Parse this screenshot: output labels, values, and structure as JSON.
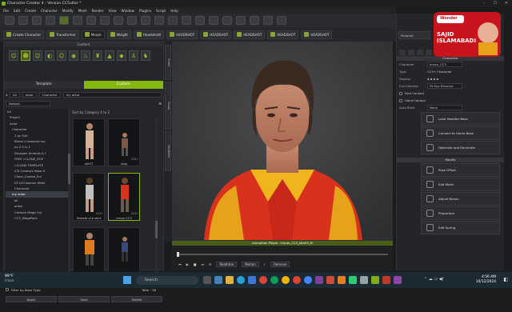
{
  "window": {
    "title": "Character Creator 4 - Version CC5ultar *"
  },
  "menu": [
    "File",
    "Edit",
    "Create",
    "Character",
    "Modify",
    "Mesh",
    "Render",
    "View",
    "Window",
    "Plugins",
    "Script",
    "Help"
  ],
  "toolbar2": {
    "create_character": "Create Character",
    "transformer": "Transformer",
    "morph_label": "Morph",
    "weight_label": "Weight",
    "pose_label": "HeadshotX",
    "headshot1": "HEADSHOT",
    "headshot2": "HEADSHOT",
    "headshot3": "HEADSHOT",
    "headshot4": "HEADSHOT",
    "headshot5": "HEADSHOT",
    "right_tab": "Pictorial"
  },
  "content": {
    "header": "Content",
    "tab_template": "Template",
    "tab_custom": "Custom",
    "path": [
      "All",
      "Actor",
      "Character",
      "my actor"
    ],
    "default_select": "Default",
    "sort_label": "Sort by Category  A to Z",
    "tree": [
      "All",
      "Project",
      "Actor",
      "Character",
      "2 pc Suit",
      "Blessi U-leashed mo",
      "Jul 2.5 & 3",
      "Draugen Animals & f",
      "FREE i-CLONE_ZOE",
      "I-CLONE TEMPLATE",
      "ICS Creature Base H",
      "Clone_Combo_Sui",
      "KT-103 Nomon Mitte",
      "Character",
      "my actor",
      "all",
      "anter",
      "Cartoon Mega Col",
      "CC3_MegaPack"
    ],
    "tiles": [
      {
        "label": "stlr07",
        "cc": ""
      },
      {
        "label": "vlog",
        "cc": "CC3+"
      },
      {
        "label": "Female v1e shirt",
        "cc": "CC3+"
      },
      {
        "label": "Imran CC3",
        "cc": "CC3+"
      },
      {
        "label": "",
        "cc": ""
      },
      {
        "label": "",
        "cc": ""
      }
    ],
    "show_subfolder": "Show Sub-folder Items",
    "filter_base": "Filter by Base Type",
    "total": "Total : 36",
    "btn_apply": "Apply",
    "btn_save": "Save",
    "btn_delete": "Delete"
  },
  "side_tabs": [
    "Scene",
    "Visual",
    "Headshot"
  ],
  "anim": {
    "title": "Animation Player : Imran_CC3_Idle03_M",
    "realtime": "Realtime",
    "motion": "Motion",
    "remove": "Remove"
  },
  "right_panel": {
    "section_character": "Character",
    "props": [
      {
        "k": "Character",
        "v": "Imran_CC3"
      },
      {
        "k": "Type",
        "v": "CC3+ Character"
      },
      {
        "k": "Display",
        "v": ""
      },
      {
        "k": "Eye Element",
        "v": "Fit Eye Element"
      }
    ],
    "foot_contact": "Foot Contact",
    "hand_contact": "Hand Contact",
    "auto_blink": "Auto Blink",
    "auto_blink_val": "None",
    "btns_top": [
      "Load Headfor Base",
      "Convert to Game Base",
      "Optimize and Decimate"
    ],
    "section_modify": "Modify",
    "btns_bottom": [
      "Pose Offset",
      "Edit Mesh",
      "Adjust Bones",
      "Proportion",
      "Edit Spring"
    ]
  },
  "overlay": {
    "channel": "SAJID ISLAMABADI",
    "brand": "Wonder"
  },
  "taskbar": {
    "temp": "89°F",
    "weather": "Haze",
    "search": "Search",
    "time": "4:56 AM",
    "date": "10/12/2024"
  }
}
